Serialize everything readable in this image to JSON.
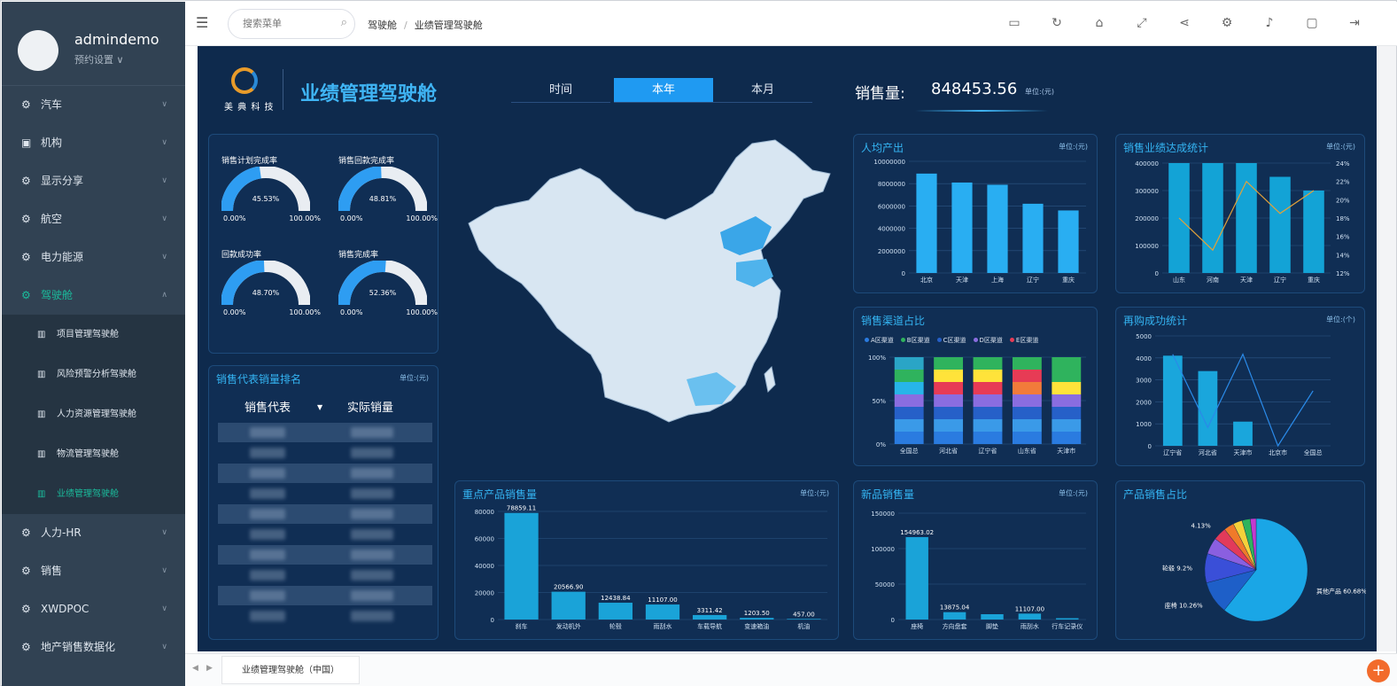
{
  "user": {
    "name": "admindemo",
    "role": "预约设置 ∨"
  },
  "menu": [
    {
      "label": "汽车",
      "icon": "gear-icon",
      "active": false
    },
    {
      "label": "机构",
      "icon": "briefcase-icon",
      "active": false
    },
    {
      "label": "显示分享",
      "icon": "gear-icon",
      "active": false
    },
    {
      "label": "航空",
      "icon": "gear-icon",
      "active": false
    },
    {
      "label": "电力能源",
      "icon": "gear-icon",
      "active": false
    },
    {
      "label": "驾驶舱",
      "icon": "gear-icon",
      "active": true
    },
    {
      "label": "人力-HR",
      "icon": "gear-icon",
      "active": false
    },
    {
      "label": "销售",
      "icon": "gear-icon",
      "active": false
    },
    {
      "label": "XWDPOC",
      "icon": "gear-icon",
      "active": false
    },
    {
      "label": "地产销售数据化",
      "icon": "gear-icon",
      "active": false
    }
  ],
  "submenu": [
    {
      "label": "项目管理驾驶舱",
      "active": false
    },
    {
      "label": "风险预警分析驾驶舱",
      "active": false
    },
    {
      "label": "人力资源管理驾驶舱",
      "active": false
    },
    {
      "label": "物流管理驾驶舱",
      "active": false
    },
    {
      "label": "业绩管理驾驶舱",
      "active": true
    }
  ],
  "topbar": {
    "search_placeholder": "搜索菜单",
    "breadcrumb": [
      "驾驶舱",
      "业绩管理驾驶舱"
    ],
    "tools": [
      "window-icon",
      "refresh-icon",
      "home-icon",
      "expand-icon",
      "share-icon",
      "settings-icon",
      "bell-icon",
      "message-icon",
      "logout-icon"
    ]
  },
  "tabbar": {
    "tab_label": "业绩管理驾驶舱（中国）"
  },
  "dashboard": {
    "logo_text": "美 典 科 技",
    "title": "业绩管理驾驶舱",
    "period_tabs": [
      {
        "label": "时间",
        "active": false
      },
      {
        "label": "本年",
        "active": true
      },
      {
        "label": "本月",
        "active": false
      }
    ],
    "sales_label": "销售量:",
    "sales_value": "848453.56",
    "sales_unit": "单位:(元)",
    "gauges": [
      {
        "title": "销售计划完成率",
        "value": "45.53%",
        "pct": 45.53,
        "min": "0.00%",
        "max": "100.00%"
      },
      {
        "title": "销售回款完成率",
        "value": "48.81%",
        "pct": 48.81,
        "min": "0.00%",
        "max": "100.00%"
      },
      {
        "title": "回款成功率",
        "value": "48.70%",
        "pct": 48.7,
        "min": "0.00%",
        "max": "100.00%"
      },
      {
        "title": "销售完成率",
        "value": "52.36%",
        "pct": 52.36,
        "min": "0.00%",
        "max": "100.00%"
      }
    ],
    "ranking": {
      "title": "销售代表销量排名",
      "unit": "单位:(元)",
      "col_name": "销售代表",
      "col_value": "实际销量",
      "row_count": 10
    },
    "panels": {
      "per_capita": {
        "title": "人均产出",
        "unit": "单位:(元)"
      },
      "region_perf": {
        "title": "销售业绩达成统计",
        "unit": "单位:(元)"
      },
      "channel": {
        "title": "销售渠道占比"
      },
      "repurchase": {
        "title": "再购成功统计",
        "unit": "单位:(个)"
      },
      "key_products": {
        "title": "重点产品销售量",
        "unit": "单位:(元)"
      },
      "new_products": {
        "title": "新品销售量",
        "unit": "单位:(元)"
      },
      "product_share": {
        "title": "产品销售占比"
      }
    }
  },
  "chart_data": [
    {
      "id": "per_capita",
      "type": "bar",
      "title": "人均产出",
      "categories": [
        "北京",
        "天津",
        "上海",
        "辽宁",
        "重庆"
      ],
      "values": [
        8900000,
        8100000,
        7900000,
        6200000,
        5600000
      ],
      "ylim": [
        0,
        10000000
      ],
      "yticks": [
        "0",
        "2000000",
        "4000000",
        "6000000",
        "8000000",
        "10000000"
      ],
      "color": "#29aef2"
    },
    {
      "id": "region_perf",
      "type": "bar",
      "title": "销售业绩达成统计",
      "categories": [
        "山东",
        "河南",
        "天津",
        "辽宁",
        "重庆"
      ],
      "values": [
        430000,
        425000,
        410000,
        350000,
        300000
      ],
      "ylim": [
        0,
        400000
      ],
      "yticks": [
        "0",
        "100000",
        "200000",
        "300000",
        "400000"
      ],
      "line": {
        "values": [
          18,
          14.5,
          22,
          18.5,
          21
        ],
        "ylim": [
          12,
          24
        ],
        "yticks": [
          "12%",
          "14%",
          "16%",
          "18%",
          "20%",
          "22%",
          "24%"
        ],
        "color": "#e1a13a"
      },
      "color": "#13a3d6"
    },
    {
      "id": "channel",
      "type": "bar",
      "stacked": true,
      "title": "销售渠道占比",
      "categories": [
        "全国总",
        "河北省",
        "辽宁省",
        "山东省",
        "天津市"
      ],
      "yticks": [
        "0%",
        "50%",
        "100%"
      ],
      "legend": [
        "A区渠道",
        "B区渠道",
        "C区渠道",
        "D区渠道",
        "E区渠道"
      ],
      "segments": [
        [
          "#2a7be0",
          "#3a9ae8",
          "#2660c8",
          "#8a6de0",
          "#27b5e8",
          "#2fb35d",
          "#2aa5c6"
        ],
        [
          "#2a7be0",
          "#3a9ae8",
          "#2660c8",
          "#8a6de0",
          "#e73b55",
          "#ffe33a",
          "#2fb35d"
        ],
        [
          "#2a7be0",
          "#3a9ae8",
          "#2660c8",
          "#8a6de0",
          "#e73b55",
          "#ffe33a",
          "#2fb35d"
        ],
        [
          "#2a7be0",
          "#3a9ae8",
          "#2660c8",
          "#8a6de0",
          "#f27b3a",
          "#e73b55",
          "#2fb35d"
        ],
        [
          "#2a7be0",
          "#3a9ae8",
          "#2660c8",
          "#8a6de0",
          "#ffe33a",
          "#2fb35d",
          "#2fb35d"
        ]
      ]
    },
    {
      "id": "repurchase",
      "type": "bar",
      "title": "再购成功统计",
      "categories": [
        "辽宁省",
        "河北省",
        "天津市",
        "北京市",
        "全国总"
      ],
      "values": [
        4100,
        3400,
        1100,
        0,
        0
      ],
      "ylim": [
        0,
        5000
      ],
      "yticks": [
        "0",
        "1000",
        "2000",
        "3000",
        "4000",
        "5000"
      ],
      "line": {
        "values": [
          100,
          20,
          100,
          0,
          60
        ],
        "ylim": [
          0,
          120
        ]
      },
      "color": "#1aa6dc"
    },
    {
      "id": "key_products",
      "type": "bar",
      "title": "重点产品销售量",
      "categories": [
        "刹车",
        "发动机外",
        "轮毂",
        "雨刮水",
        "车载导航",
        "变速箱油",
        "机油"
      ],
      "values": [
        78859.11,
        20566.9,
        12438.84,
        11107.0,
        3311.42,
        1203.5,
        457.0
      ],
      "labels": [
        "78859.11",
        "20566.90",
        "12438.84",
        "11107.00",
        "3311.42",
        "1203.50",
        "457.00"
      ],
      "ylim": [
        0,
        80000
      ],
      "yticks": [
        "0",
        "20000",
        "40000",
        "60000",
        "80000"
      ],
      "color": "#1aa3d8"
    },
    {
      "id": "new_products",
      "type": "bar",
      "title": "新品销售量",
      "categories": [
        "座椅",
        "方向盘套",
        "脚垫",
        "雨刮水",
        "行车记录仪"
      ],
      "values": [
        154963.02,
        13875.04,
        10000,
        11107.0,
        2500
      ],
      "labels": [
        "154963.02",
        "13875.04",
        "",
        "11107.00",
        ""
      ],
      "ylim": [
        0,
        200000
      ],
      "yticks": [
        "0",
        "50000",
        "100000",
        "150000"
      ],
      "color": "#1aa3d8"
    },
    {
      "id": "product_share",
      "type": "pie",
      "title": "产品销售占比",
      "slices": [
        {
          "label": "其他产品 60.68%",
          "value": 60.68,
          "color": "#1aa6e6"
        },
        {
          "label": "座椅 10.26%",
          "value": 10.26,
          "color": "#1e5fc8"
        },
        {
          "label": "轮毂 9.2%",
          "value": 9.2,
          "color": "#3a4fd8"
        },
        {
          "label": "",
          "value": 5.2,
          "color": "#8a5fe0"
        },
        {
          "label": "4.13%",
          "value": 4.13,
          "color": "#e23a5a"
        },
        {
          "label": "",
          "value": 3.2,
          "color": "#f07a2a"
        },
        {
          "label": "",
          "value": 2.9,
          "color": "#f5d13a"
        },
        {
          "label": "",
          "value": 2.6,
          "color": "#2fb35d"
        },
        {
          "label": "",
          "value": 1.83,
          "color": "#c23ad0"
        }
      ]
    }
  ]
}
